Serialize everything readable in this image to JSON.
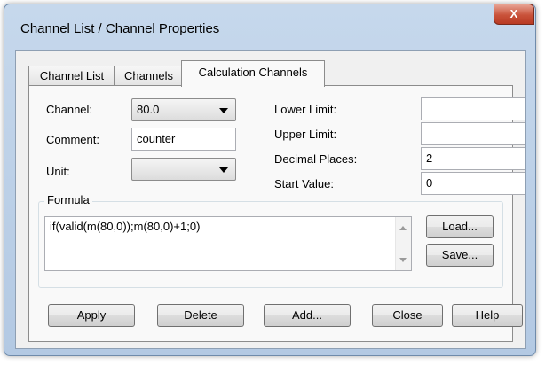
{
  "window": {
    "title": "Channel List / Channel Properties",
    "close_glyph": "X"
  },
  "tabs": [
    {
      "label": "Channel List"
    },
    {
      "label": "Channels"
    },
    {
      "label": "Calculation Channels"
    }
  ],
  "form": {
    "channel_label": "Channel:",
    "channel_value": "80.0",
    "comment_label": "Comment:",
    "comment_value": "counter",
    "unit_label": "Unit:",
    "unit_value": "",
    "lower_limit_label": "Lower Limit:",
    "lower_limit_value": "",
    "upper_limit_label": "Upper Limit:",
    "upper_limit_value": "",
    "decimal_places_label": "Decimal Places:",
    "decimal_places_value": "2",
    "start_value_label": "Start Value:",
    "start_value_value": "0"
  },
  "formula": {
    "group_title": "Formula",
    "text": "if(valid(m(80,0));m(80,0)+1;0)",
    "load_label": "Load...",
    "save_label": "Save..."
  },
  "buttons": {
    "apply": "Apply",
    "delete": "Delete",
    "add": "Add...",
    "close": "Close",
    "help": "Help"
  }
}
